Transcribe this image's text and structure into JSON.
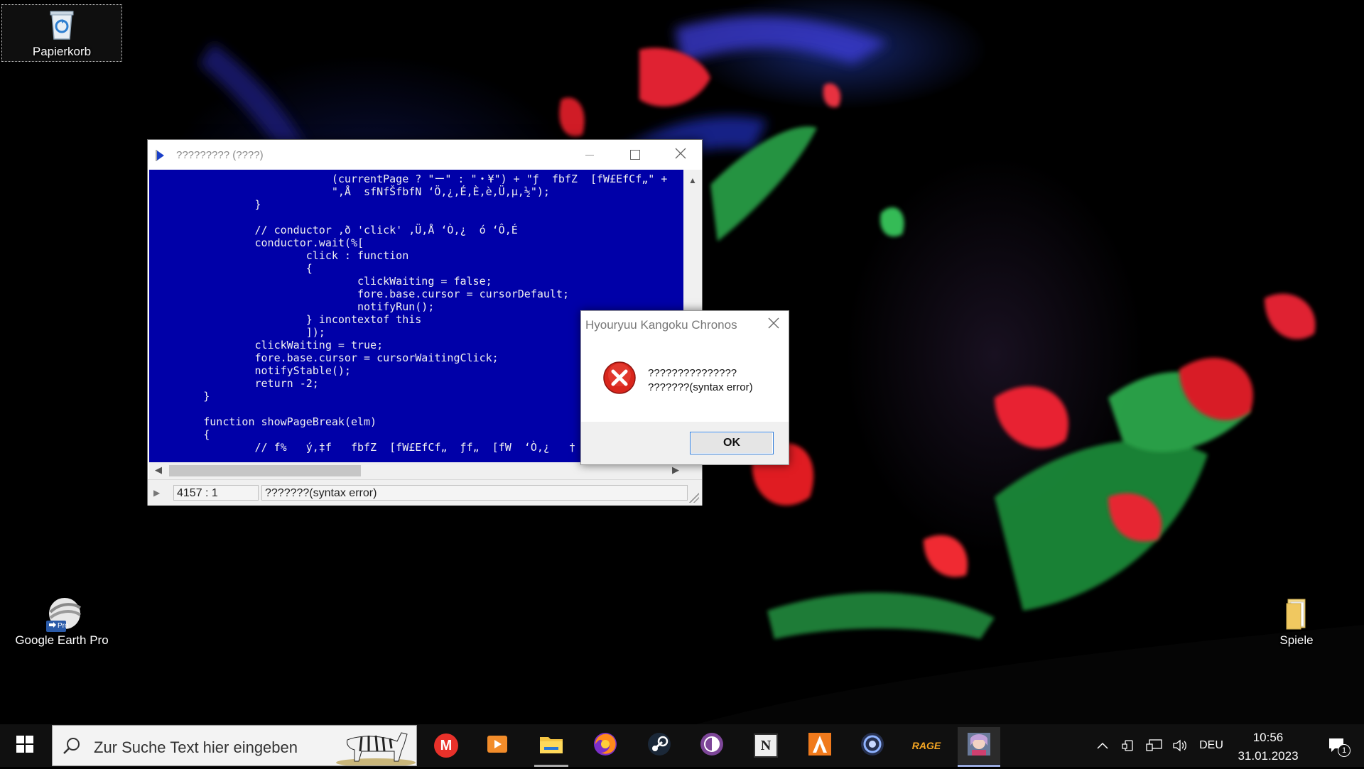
{
  "desktop": {
    "icons": [
      {
        "label": "Papierkorb"
      },
      {
        "label": "Google Earth Pro",
        "badge": "Pro"
      },
      {
        "label": "Spiele"
      }
    ]
  },
  "editor": {
    "title": "????????? (????)",
    "code_lines": [
      "                            (currentPage ? \"ー\" : \"・¥\") + \"ƒ  fbfZ  [fW£EfCf„\" +",
      "                            \",Å  sfNfŠfbfN ‘Ö,¿,É,È,è,Ü,µ,½\");",
      "                }",
      "",
      "                // conductor ,ð 'click' ,Ü,Å ‘Ò,¿  ó ‘Ô,É",
      "                conductor.wait(%[",
      "                        click : function",
      "                        {",
      "                                clickWaiting = false;",
      "                                fore.base.cursor = cursorDefault;",
      "                                notifyRun();",
      "                        } incontextof this",
      "                        ]);",
      "                clickWaiting = true;",
      "                fore.base.cursor = cursorWaitingClick;",
      "                notifyStable();",
      "                return -2;",
      "        }",
      "",
      "        function showPageBreak(elm)",
      "        {",
      "                // f%   ý,‡f   fbfZ  [fW£EfCf„  ƒf„  [fW  ‘Ò,¿   † ¾,ª"
    ],
    "status": {
      "position": "4157 : 1",
      "message": "???????(syntax error)"
    }
  },
  "dialog": {
    "title": "Hyouryuu Kangoku Chronos",
    "message_line1": "???????????????",
    "message_line2": "???????(syntax error)",
    "ok_label": "OK"
  },
  "taskbar": {
    "search_placeholder": "Zur Suche Text hier eingeben",
    "apps": [
      {
        "name": "mega",
        "label": "M"
      },
      {
        "name": "media-player"
      },
      {
        "name": "file-explorer"
      },
      {
        "name": "firefox"
      },
      {
        "name": "steam"
      },
      {
        "name": "tor"
      },
      {
        "name": "notepad-n",
        "label": "N"
      },
      {
        "name": "app-a"
      },
      {
        "name": "app-circle"
      },
      {
        "name": "rage",
        "label": "RAGE"
      },
      {
        "name": "game-app"
      }
    ],
    "tray": {
      "language": "DEU",
      "time": "10:56",
      "date": "31.01.2023",
      "notification_count": "1"
    }
  },
  "colors": {
    "code_background": "#0000a8",
    "taskbar": "#101010",
    "error_red": "#d9261c"
  }
}
